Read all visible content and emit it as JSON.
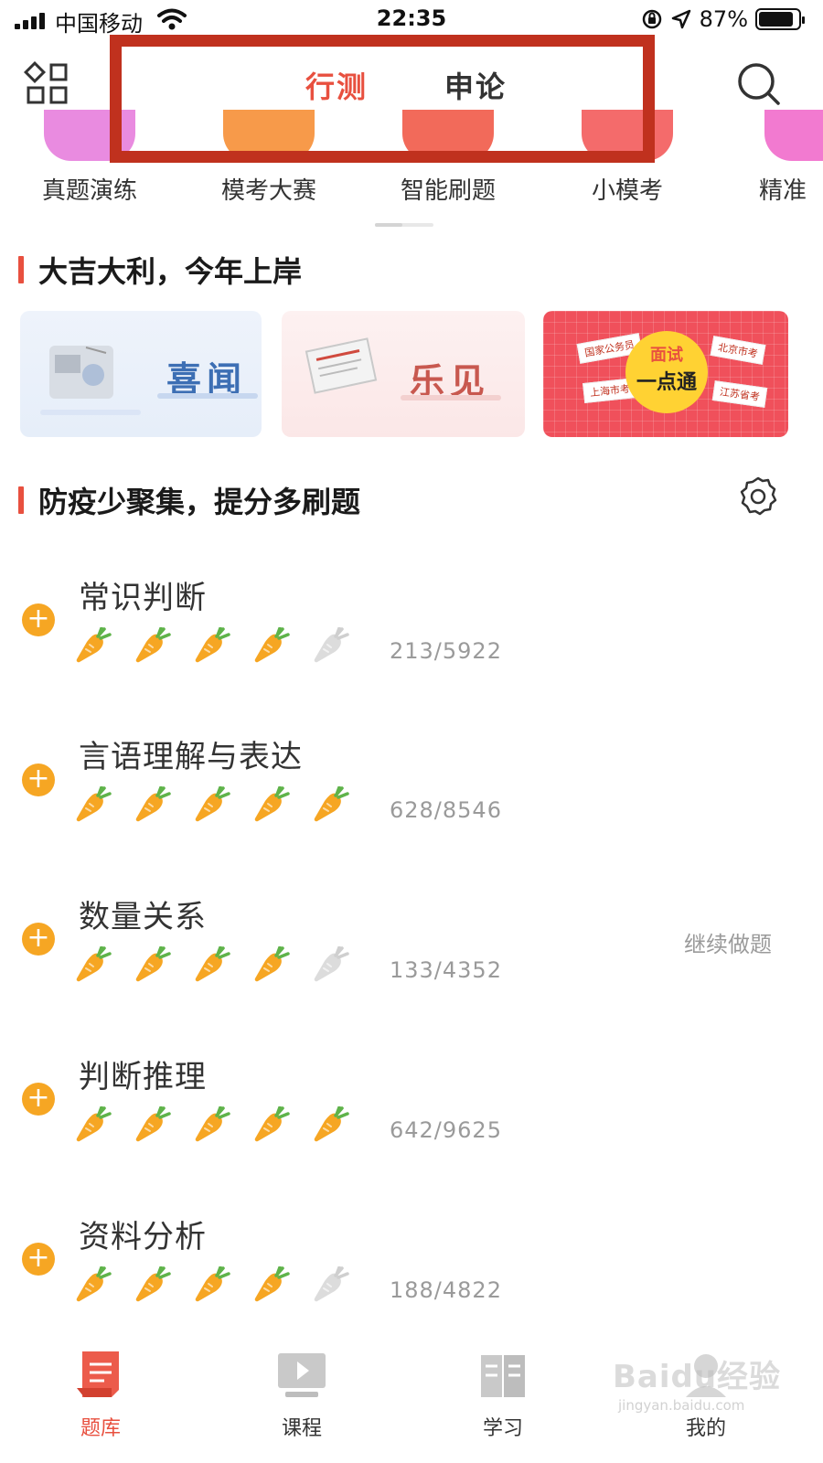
{
  "status_bar": {
    "carrier": "中国移动",
    "time": "22:35",
    "battery_percent": "87%",
    "battery_level": 0.87
  },
  "nav": {
    "tabs": [
      {
        "label": "行测",
        "active": true
      },
      {
        "label": "申论",
        "active": false
      }
    ],
    "left_icon": "grid-icon",
    "right_icon": "search-icon",
    "annotation_color": "#c0311e"
  },
  "categories": [
    {
      "label": "真题演练",
      "color": "#e98be0"
    },
    {
      "label": "模考大赛",
      "color": "#f79a4a"
    },
    {
      "label": "智能刷题",
      "color": "#f26a5a"
    },
    {
      "label": "小模考",
      "color": "#f46b6b"
    },
    {
      "label": "精准",
      "color": "#f27ad0"
    }
  ],
  "section1": {
    "title": "大吉大利，今年上岸",
    "banners": [
      {
        "label": "喜闻",
        "icon": "radio-icon",
        "color": "#3d6fb4"
      },
      {
        "label": "乐见",
        "icon": "newspaper-icon",
        "color": "#c8584f"
      },
      {
        "label": "面试",
        "label2": "一点通",
        "tags": [
          "国家公务员",
          "北京市考",
          "上海市考",
          "江苏省考"
        ],
        "color": "#f0505b"
      }
    ]
  },
  "section2": {
    "title": "防疫少聚集，提分多刷题",
    "settings_icon": "gear-icon"
  },
  "subjects": [
    {
      "name": "常识判断",
      "progress": "213/5922",
      "rating": 4,
      "max_rating": 5,
      "action": ""
    },
    {
      "name": "言语理解与表达",
      "progress": "628/8546",
      "rating": 5,
      "max_rating": 5,
      "action": ""
    },
    {
      "name": "数量关系",
      "progress": "133/4352",
      "rating": 4,
      "max_rating": 5,
      "action": "继续做题"
    },
    {
      "name": "判断推理",
      "progress": "642/9625",
      "rating": 5,
      "max_rating": 5,
      "action": ""
    },
    {
      "name": "资料分析",
      "progress": "188/4822",
      "rating": 4,
      "max_rating": 5,
      "action": ""
    }
  ],
  "tab_bar": {
    "items": [
      {
        "label": "题库",
        "icon": "question-bank-icon",
        "active": true
      },
      {
        "label": "课程",
        "icon": "course-play-icon",
        "active": false
      },
      {
        "label": "学习",
        "icon": "book-icon",
        "active": false
      },
      {
        "label": "我的",
        "icon": "profile-icon",
        "active": false
      }
    ]
  },
  "watermark": {
    "brand": "Baidu经验",
    "url": "jingyan.baidu.com"
  },
  "colors": {
    "accent": "#e8503f",
    "plus": "#f6a623",
    "carrot": "#f6a623",
    "carrot_empty": "#dcdcdc"
  }
}
